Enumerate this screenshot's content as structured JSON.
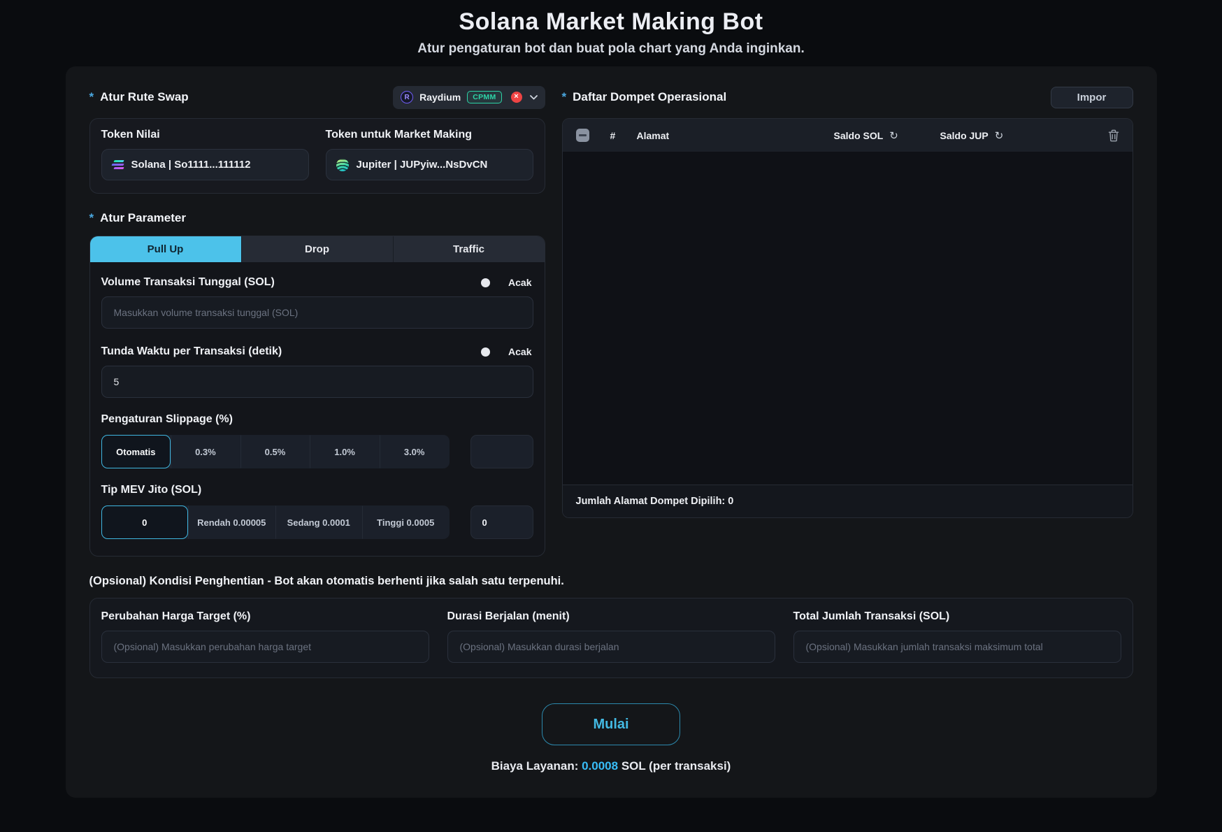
{
  "page": {
    "title": "Solana Market Making Bot",
    "subtitle": "Atur pengaturan bot dan buat pola chart yang Anda inginkan."
  },
  "swap_route": {
    "required_mark": "*",
    "title": "Atur Rute Swap",
    "dex_selector": {
      "icon_letter": "R",
      "name": "Raydium",
      "badge": "CPMM",
      "clear_glyph": "×"
    },
    "base_token": {
      "label": "Token Nilai",
      "value": "Solana | So1111...111112"
    },
    "mm_token": {
      "label": "Token untuk Market Making",
      "value": "Jupiter | JUPyiw...NsDvCN"
    }
  },
  "parameters": {
    "required_mark": "*",
    "title": "Atur Parameter",
    "tabs": [
      {
        "label": "Pull Up",
        "active": true
      },
      {
        "label": "Drop",
        "active": false
      },
      {
        "label": "Traffic",
        "active": false
      }
    ],
    "volume": {
      "label": "Volume Transaksi Tunggal (SOL)",
      "random_label": "Acak",
      "placeholder": "Masukkan volume transaksi tunggal (SOL)",
      "value": ""
    },
    "delay": {
      "label": "Tunda Waktu per Transaksi (detik)",
      "random_label": "Acak",
      "value": "5"
    },
    "slippage": {
      "label": "Pengaturan Slippage (%)",
      "options": [
        "Otomatis",
        "0.3%",
        "0.5%",
        "1.0%",
        "3.0%"
      ],
      "active_option": "Otomatis",
      "custom_value": ""
    },
    "jito_tip": {
      "label": "Tip MEV Jito (SOL)",
      "options": [
        "0",
        "Rendah 0.00005",
        "Sedang 0.0001",
        "Tinggi 0.0005"
      ],
      "active_option": "0",
      "custom_value": "0"
    }
  },
  "wallets": {
    "required_mark": "*",
    "title": "Daftar Dompet Operasional",
    "import_label": "Impor",
    "columns": {
      "index": "#",
      "address": "Alamat",
      "sol": "Saldo SOL",
      "jup": "Saldo JUP"
    },
    "refresh_glyph": "↻",
    "rows": [],
    "footer": "Jumlah Alamat Dompet Dipilih: 0"
  },
  "stop_conditions": {
    "title": "(Opsional) Kondisi Penghentian - Bot akan otomatis berhenti jika salah satu terpenuhi.",
    "fields": [
      {
        "label": "Perubahan Harga Target (%)",
        "placeholder": "(Opsional) Masukkan perubahan harga target"
      },
      {
        "label": "Durasi Berjalan (menit)",
        "placeholder": "(Opsional) Masukkan durasi berjalan"
      },
      {
        "label": "Total Jumlah Transaksi (SOL)",
        "placeholder": "(Opsional) Masukkan jumlah transaksi maksimum total"
      }
    ]
  },
  "footer": {
    "start_label": "Mulai",
    "fee_prefix": "Biaya Layanan: ",
    "fee_value": "0.0008",
    "fee_suffix": " SOL (per transaksi)"
  },
  "colors": {
    "accent_cyan": "#4cc2ea",
    "link_blue": "#38bdf8",
    "badge_teal": "#2dd4a7",
    "danger_red": "#ee4444",
    "page_bg": "#0a0c0f",
    "card_bg": "#141619"
  }
}
